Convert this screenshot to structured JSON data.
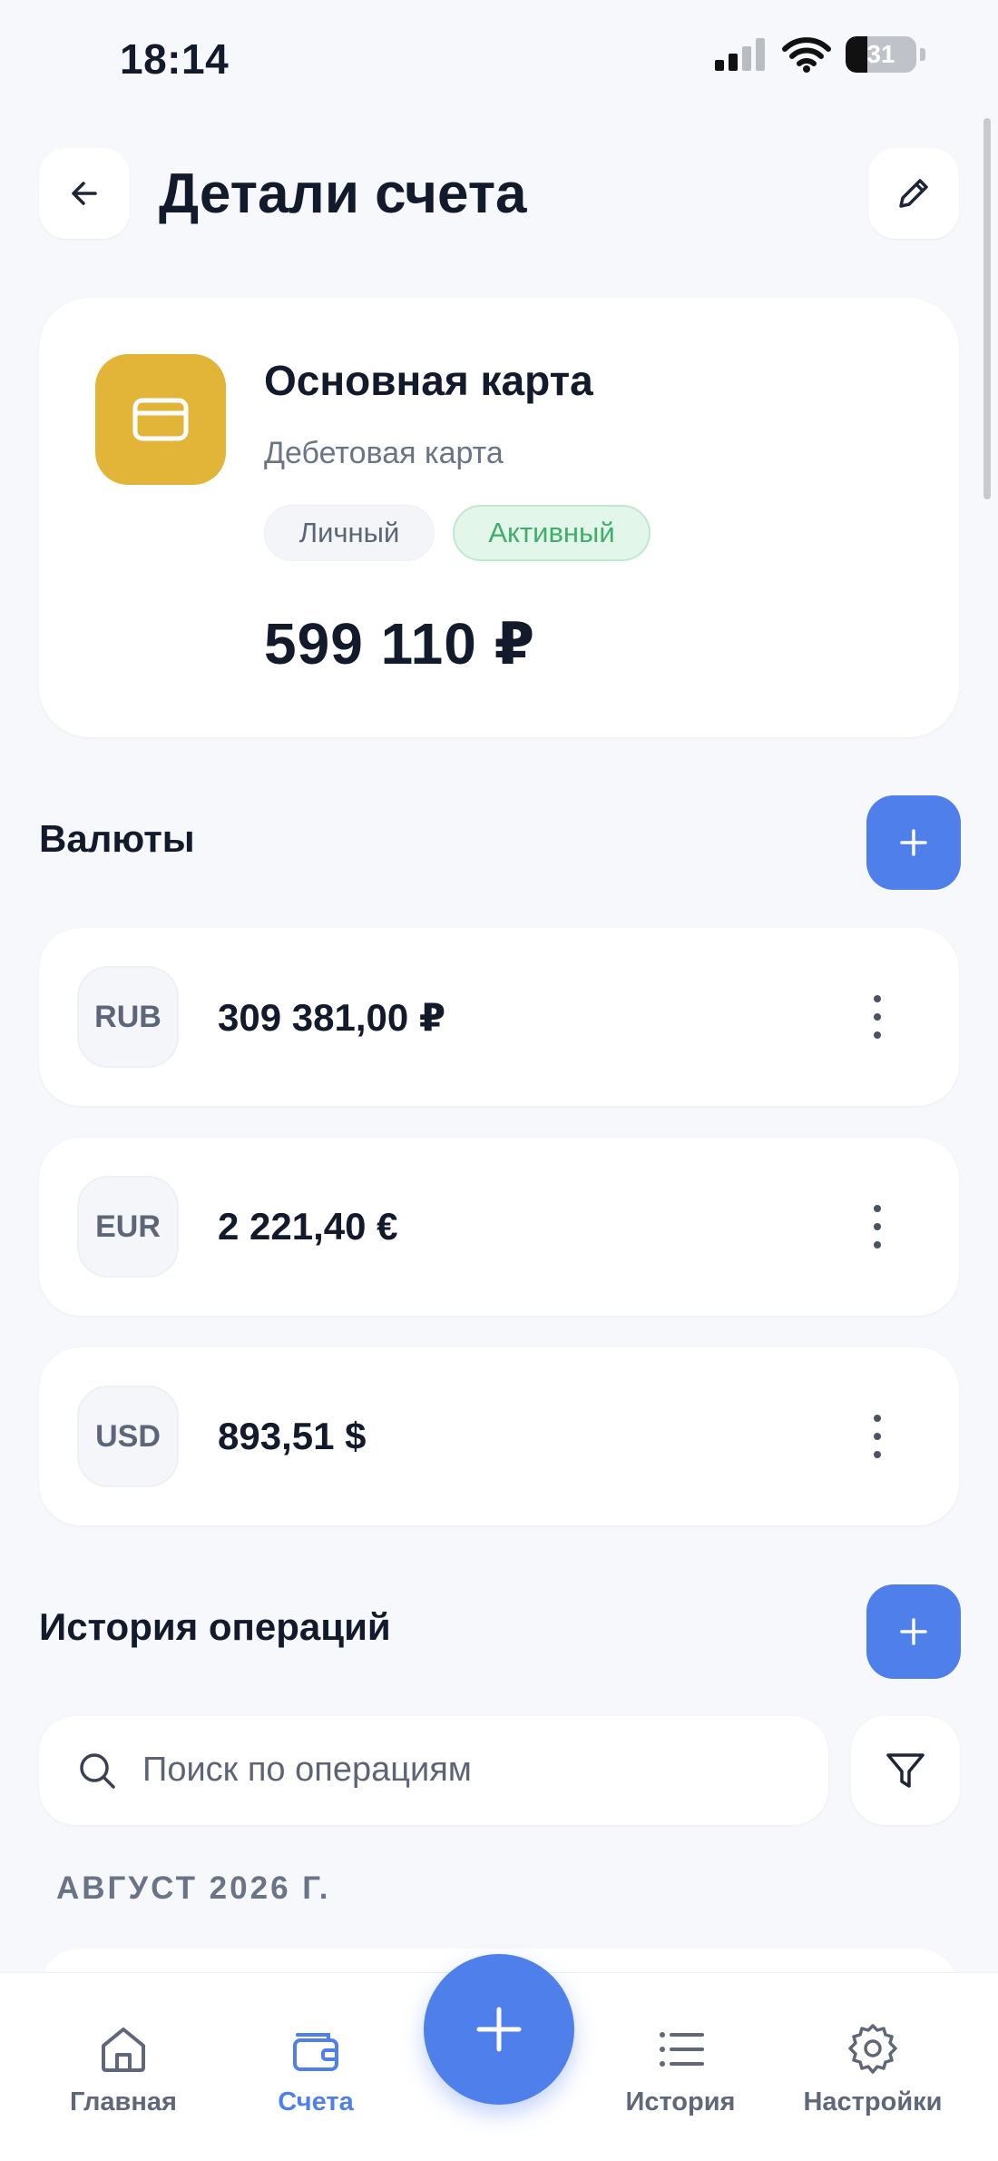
{
  "status_bar": {
    "time": "18:14",
    "battery": "31",
    "battery_level": 0.31
  },
  "header": {
    "title": "Детали счета"
  },
  "account": {
    "name": "Основная карта",
    "type": "Дебетовая карта",
    "tags": [
      "Личный",
      "Активный"
    ],
    "balance": "599 110 ₽",
    "icon": "card-icon",
    "icon_color": "#e2b538"
  },
  "currencies": {
    "title": "Валюты",
    "items": [
      {
        "code": "RUB",
        "amount": "309 381,00 ₽"
      },
      {
        "code": "EUR",
        "amount": "2 221,40 €"
      },
      {
        "code": "USD",
        "amount": "893,51 $"
      }
    ]
  },
  "history": {
    "title": "История операций",
    "search_placeholder": "Поиск по операциям",
    "month": "АВГУСТ 2026 Г."
  },
  "nav": {
    "items": [
      {
        "label": "Главная",
        "icon": "home-icon",
        "active": false
      },
      {
        "label": "Счета",
        "icon": "wallet-icon",
        "active": true
      },
      {
        "label": "История",
        "icon": "list-icon",
        "active": false
      },
      {
        "label": "Настройки",
        "icon": "gear-icon",
        "active": false
      }
    ]
  },
  "colors": {
    "accent": "#4f7fea",
    "active_tag": "#3fae6a",
    "background": "#f6f8fb"
  }
}
